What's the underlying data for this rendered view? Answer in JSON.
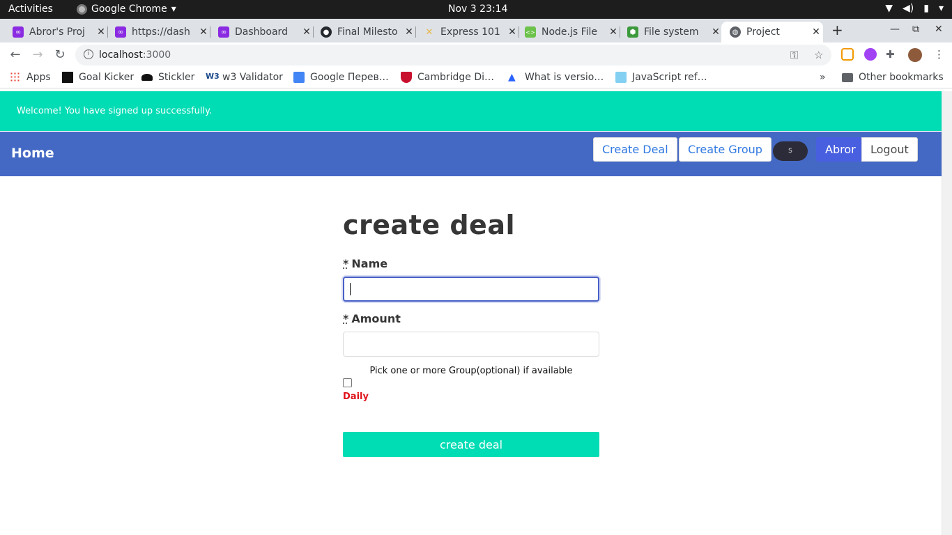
{
  "system": {
    "activities": "Activities",
    "app_name": "Google Chrome",
    "clock": "Nov 3  23:14"
  },
  "tabs": [
    {
      "title": "Abror's Proj",
      "color": "#8a2be2",
      "active": false
    },
    {
      "title": "https://dash",
      "color": "#8a2be2",
      "active": false
    },
    {
      "title": "Dashboard",
      "color": "#8a2be2",
      "active": false
    },
    {
      "title": "Final Milesto",
      "color": "#24292e",
      "active": false
    },
    {
      "title": "Express 101",
      "color": "#e8b84a",
      "active": false
    },
    {
      "title": "Node.js File",
      "color": "#6cc24a",
      "active": false
    },
    {
      "title": "File system",
      "color": "#3c9a3c",
      "active": false
    },
    {
      "title": "Project",
      "color": "#5f6368",
      "active": true
    }
  ],
  "omnibox": {
    "host": "localhost",
    "port": ":3000"
  },
  "bookmarks": {
    "items": [
      {
        "label": "Apps"
      },
      {
        "label": "Goal Kicker"
      },
      {
        "label": "Stickler"
      },
      {
        "label": "w3 Validator"
      },
      {
        "label": "Google Перев…"
      },
      {
        "label": "Cambridge Di…"
      },
      {
        "label": "What is versio…"
      },
      {
        "label": "JavaScript ref…"
      }
    ],
    "overflow": "»",
    "other": "Other bookmarks"
  },
  "flash": {
    "message": "Welcome! You have signed up successfully."
  },
  "navbar": {
    "home": "Home",
    "create_deal": "Create Deal",
    "create_group": "Create Group",
    "toggle_text": "S",
    "user": "Abror",
    "logout": "Logout"
  },
  "form": {
    "title": "create deal",
    "required_mark": "*",
    "name_label": "Name",
    "name_value": "",
    "amount_label": "Amount",
    "amount_value": "",
    "group_hint": "Pick one or more Group(optional) if available",
    "daily_label": "Daily",
    "daily_checked": false,
    "submit": "create deal"
  },
  "colors": {
    "flash_bg": "#00dcb4",
    "navbar_bg": "#4469c4",
    "user_button": "#485fe0",
    "daily_text": "#e0121b"
  }
}
